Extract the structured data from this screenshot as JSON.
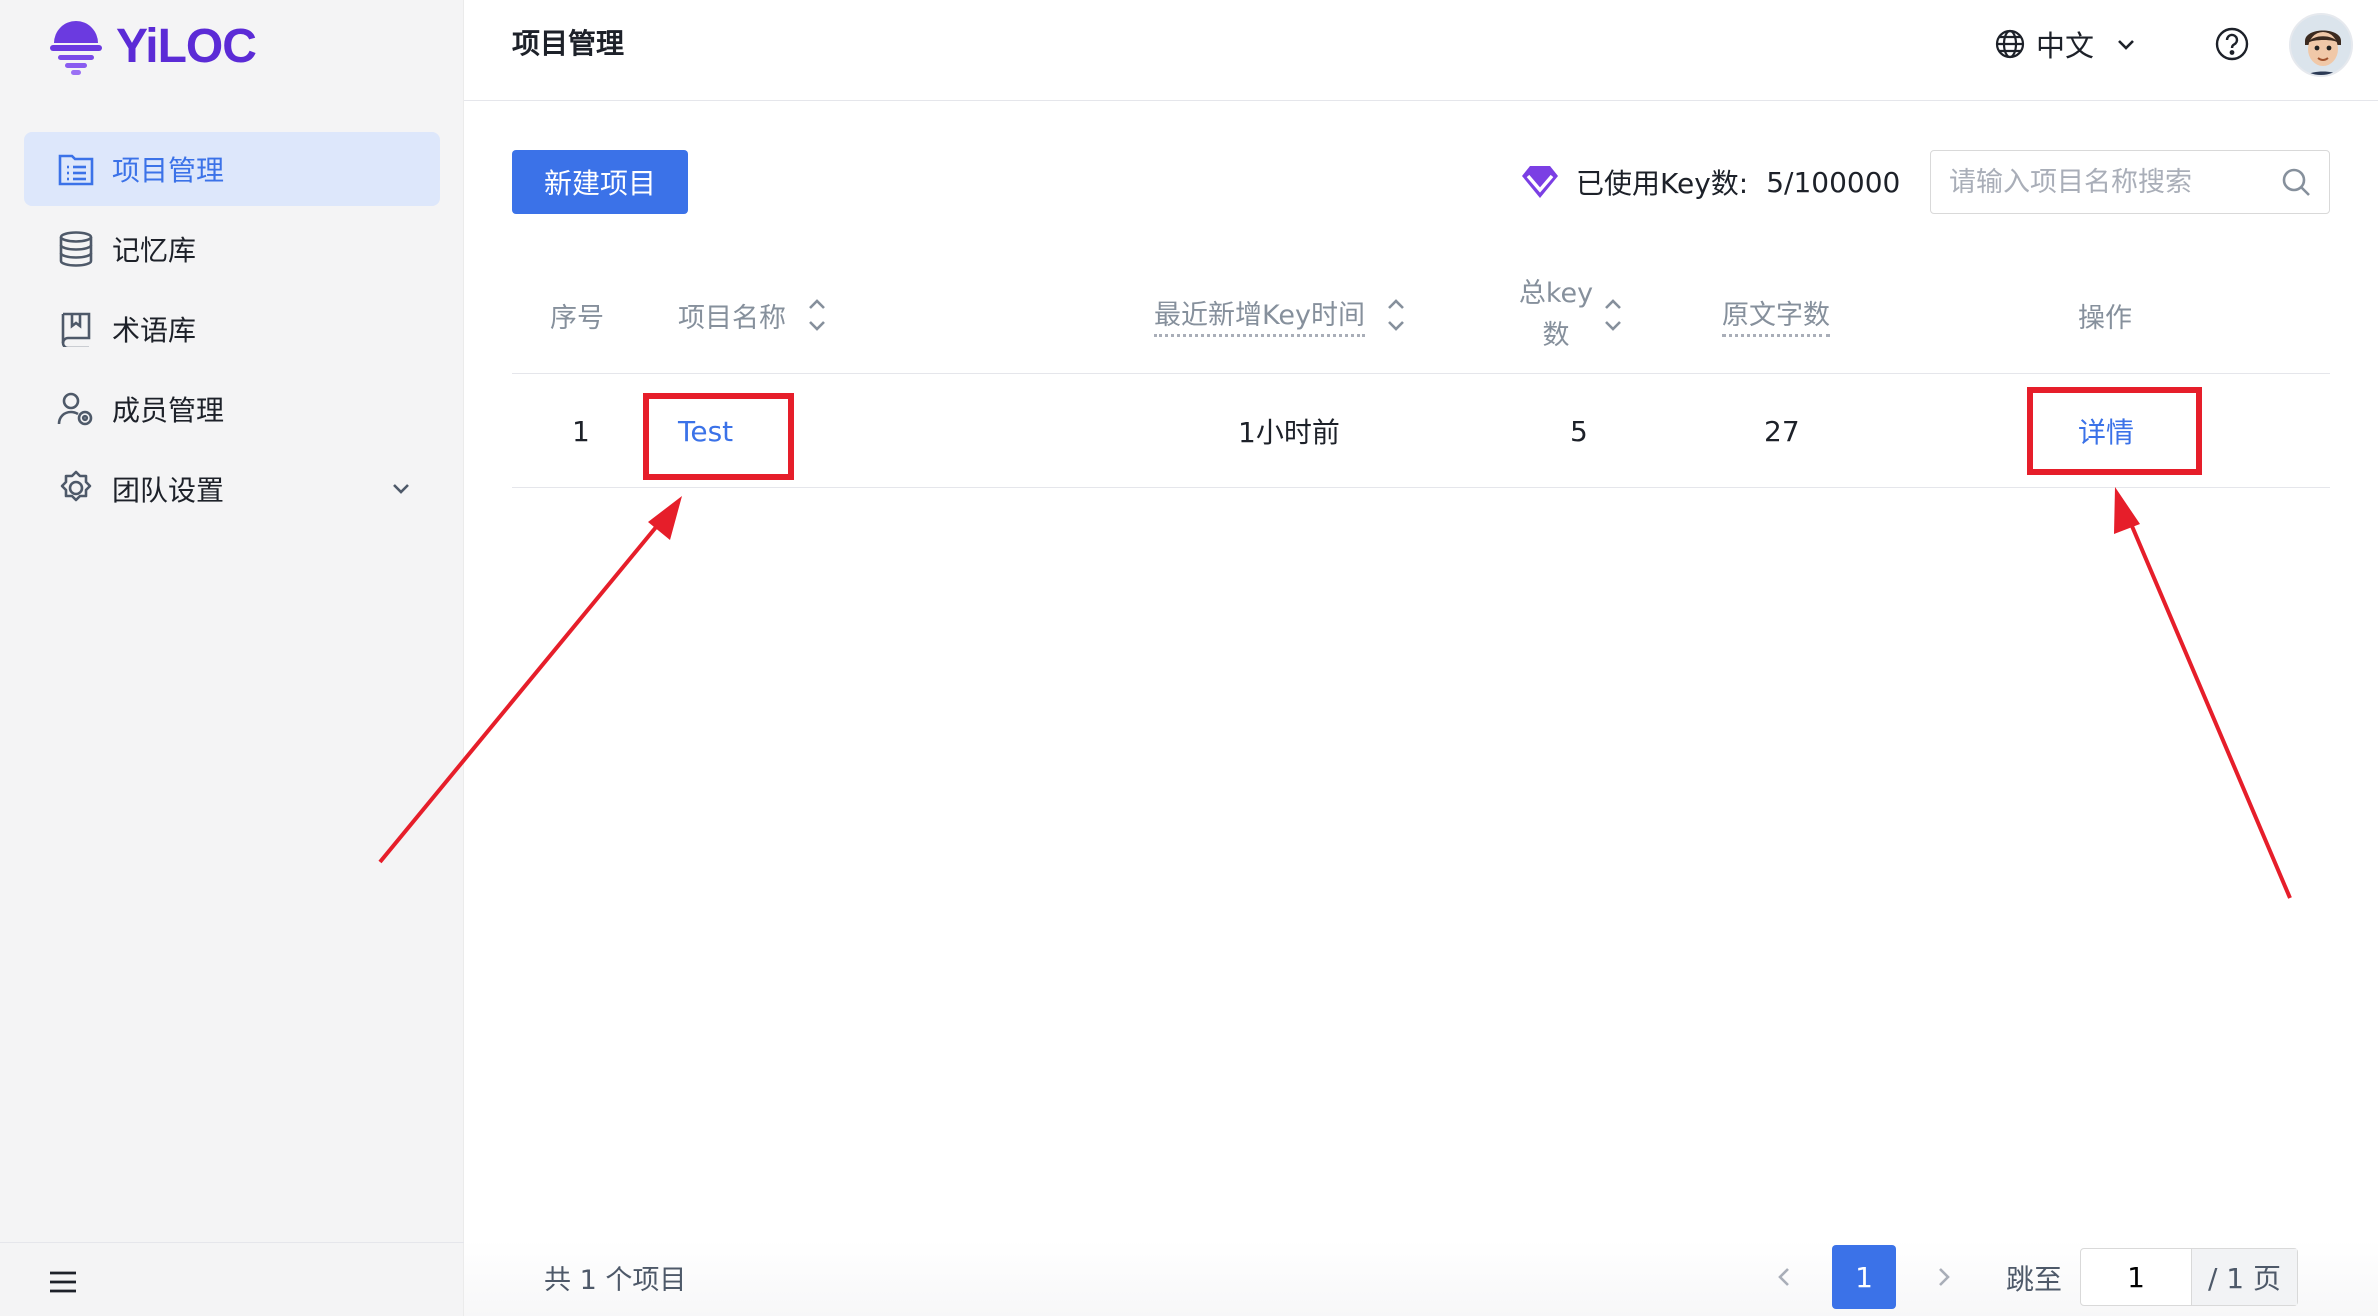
{
  "brand": {
    "name": "YiLOC",
    "color": "#5b2bd6"
  },
  "sidebar": {
    "items": [
      {
        "label": "项目管理",
        "icon": "project-list-icon",
        "active": true
      },
      {
        "label": "记忆库",
        "icon": "database-icon",
        "active": false
      },
      {
        "label": "术语库",
        "icon": "book-icon",
        "active": false
      },
      {
        "label": "成员管理",
        "icon": "member-settings-icon",
        "active": false
      },
      {
        "label": "团队设置",
        "icon": "gear-icon",
        "active": false,
        "expandable": true
      }
    ]
  },
  "header": {
    "title": "项目管理",
    "language": "中文"
  },
  "toolbar": {
    "new_project_label": "新建项目",
    "key_usage_label": "已使用Key数:",
    "key_usage_value": "5/100000",
    "search_placeholder": "请输入项目名称搜索"
  },
  "table": {
    "columns": {
      "index": "序号",
      "name": "项目名称",
      "last_key_time": "最近新增Key时间",
      "total_keys_line1": "总key",
      "total_keys_line2": "数",
      "source_chars": "原文字数",
      "actions": "操作"
    },
    "rows": [
      {
        "index": "1",
        "name": "Test",
        "last_key_time": "1小时前",
        "total_keys": "5",
        "source_chars": "27",
        "action": "详情"
      }
    ]
  },
  "pagination": {
    "total_text": "共 1 个项目",
    "current_page": "1",
    "jump_label": "跳至",
    "jump_value": "1",
    "page_total_text": "/ 1 页"
  },
  "colors": {
    "accent": "#3b72e8",
    "annotation": "#e61e2a",
    "sidebar_active_bg": "#dde7fb"
  }
}
